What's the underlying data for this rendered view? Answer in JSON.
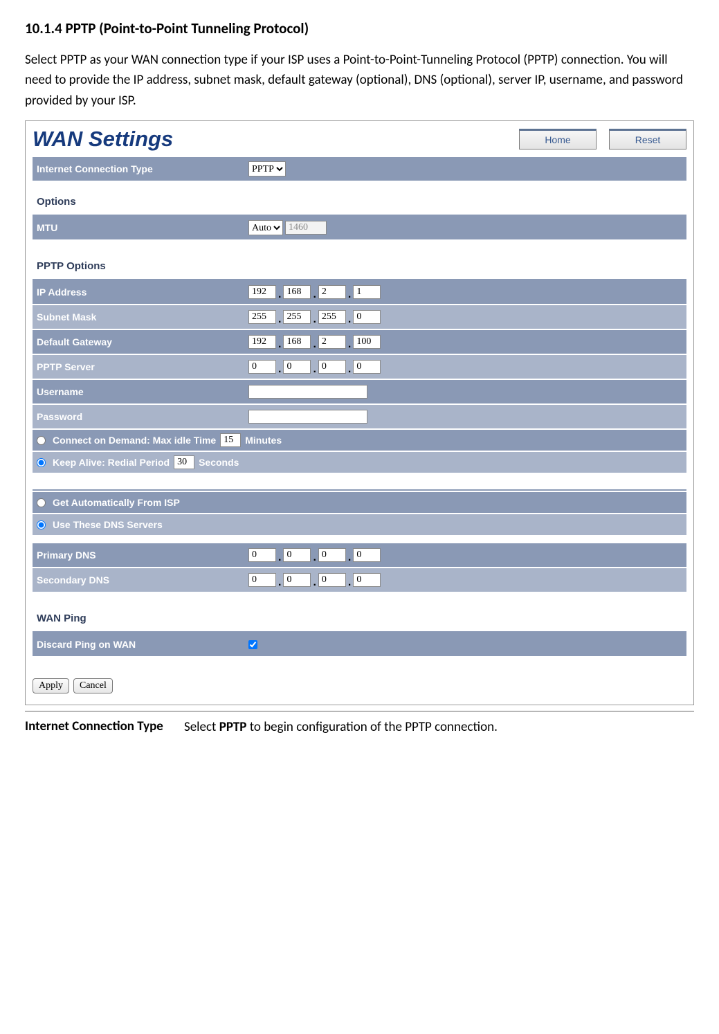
{
  "heading": "10.1.4 PPTP (Point-to-Point Tunneling Protocol)",
  "intro": "Select PPTP as your WAN connection type if your ISP uses a Point-to-Point-Tunneling Protocol (PPTP) connection. You will need to provide the IP address, subnet mask, default gateway (optional), DNS (optional), server IP, username, and password provided by your ISP.",
  "panel": {
    "title": "WAN Settings",
    "buttons": {
      "home": "Home",
      "reset": "Reset"
    },
    "connection_type": {
      "label": "Internet Connection Type",
      "value": "PPTP"
    },
    "options_heading": "Options",
    "mtu": {
      "label": "MTU",
      "mode": "Auto",
      "value": "1460"
    },
    "pptp_heading": "PPTP Options",
    "ip_address": {
      "label": "IP Address",
      "o": [
        "192",
        "168",
        "2",
        "1"
      ]
    },
    "subnet_mask": {
      "label": "Subnet Mask",
      "o": [
        "255",
        "255",
        "255",
        "0"
      ]
    },
    "default_gateway": {
      "label": "Default Gateway",
      "o": [
        "192",
        "168",
        "2",
        "100"
      ]
    },
    "pptp_server": {
      "label": "PPTP Server",
      "o": [
        "0",
        "0",
        "0",
        "0"
      ]
    },
    "username": {
      "label": "Username",
      "value": ""
    },
    "password": {
      "label": "Password",
      "value": ""
    },
    "connect_demand": {
      "label_before": "Connect on Demand: Max idle Time",
      "value": "15",
      "label_after": "Minutes"
    },
    "keep_alive": {
      "label_before": "Keep Alive: Redial Period",
      "value": "30",
      "label_after": "Seconds"
    },
    "dns_auto": "Get Automatically From ISP",
    "dns_manual": "Use These DNS Servers",
    "primary_dns": {
      "label": "Primary DNS",
      "o": [
        "0",
        "0",
        "0",
        "0"
      ]
    },
    "secondary_dns": {
      "label": "Secondary DNS",
      "o": [
        "0",
        "0",
        "0",
        "0"
      ]
    },
    "wan_ping_heading": "WAN Ping",
    "discard_ping": {
      "label": "Discard Ping on WAN",
      "checked": true
    },
    "apply": "Apply",
    "cancel": "Cancel"
  },
  "desc": {
    "label": "Internet Connection Type",
    "text_before": "Select ",
    "text_bold": "PPTP",
    "text_after": " to begin configuration of the PPTP connection."
  }
}
